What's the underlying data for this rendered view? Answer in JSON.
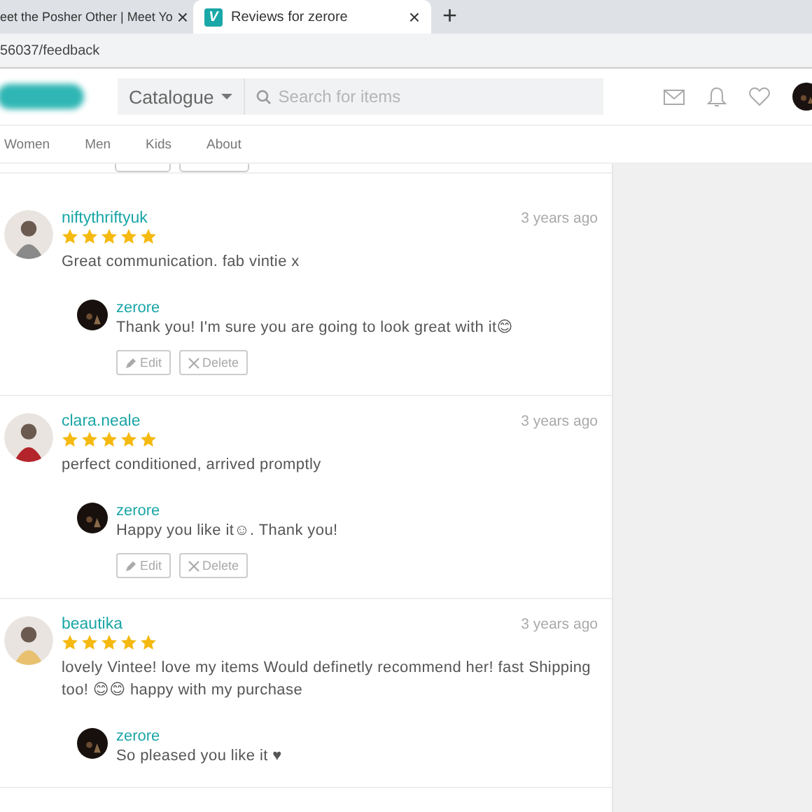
{
  "browser": {
    "tabs": [
      {
        "title": "eet the Posher Other | Meet Yo",
        "selected": false
      },
      {
        "favicon": "V",
        "title": "Reviews for zerore",
        "selected": true
      }
    ],
    "new_tab": "+",
    "close": "×",
    "address": "56037/feedback"
  },
  "header": {
    "catalogue": "Catalogue",
    "search": {
      "placeholder": "Search for items"
    }
  },
  "nav": [
    "Women",
    "Men",
    "Kids",
    "About"
  ],
  "reviews": [
    {
      "user": "niftythriftyuk",
      "time": "3 years ago",
      "stars": 5,
      "text": "Great communication. fab vintie x",
      "reply": {
        "user": "zerore",
        "text": "Thank you! I'm sure you are going to look great with it😊",
        "actions": [
          "Edit",
          "Delete"
        ]
      }
    },
    {
      "user": "clara.neale",
      "time": "3 years ago",
      "stars": 5,
      "text": "perfect conditioned, arrived promptly",
      "reply": {
        "user": "zerore",
        "text": "Happy you like it☺. Thank you!",
        "actions": [
          "Edit",
          "Delete"
        ]
      }
    },
    {
      "user": "beautika",
      "time": "3 years ago",
      "stars": 5,
      "text": "lovely Vintee! love my items Would definetly recommend her! fast Shipping too! 😊😊 happy with my purchase",
      "reply": {
        "user": "zerore",
        "text": "So pleased you like it ♥"
      }
    }
  ]
}
